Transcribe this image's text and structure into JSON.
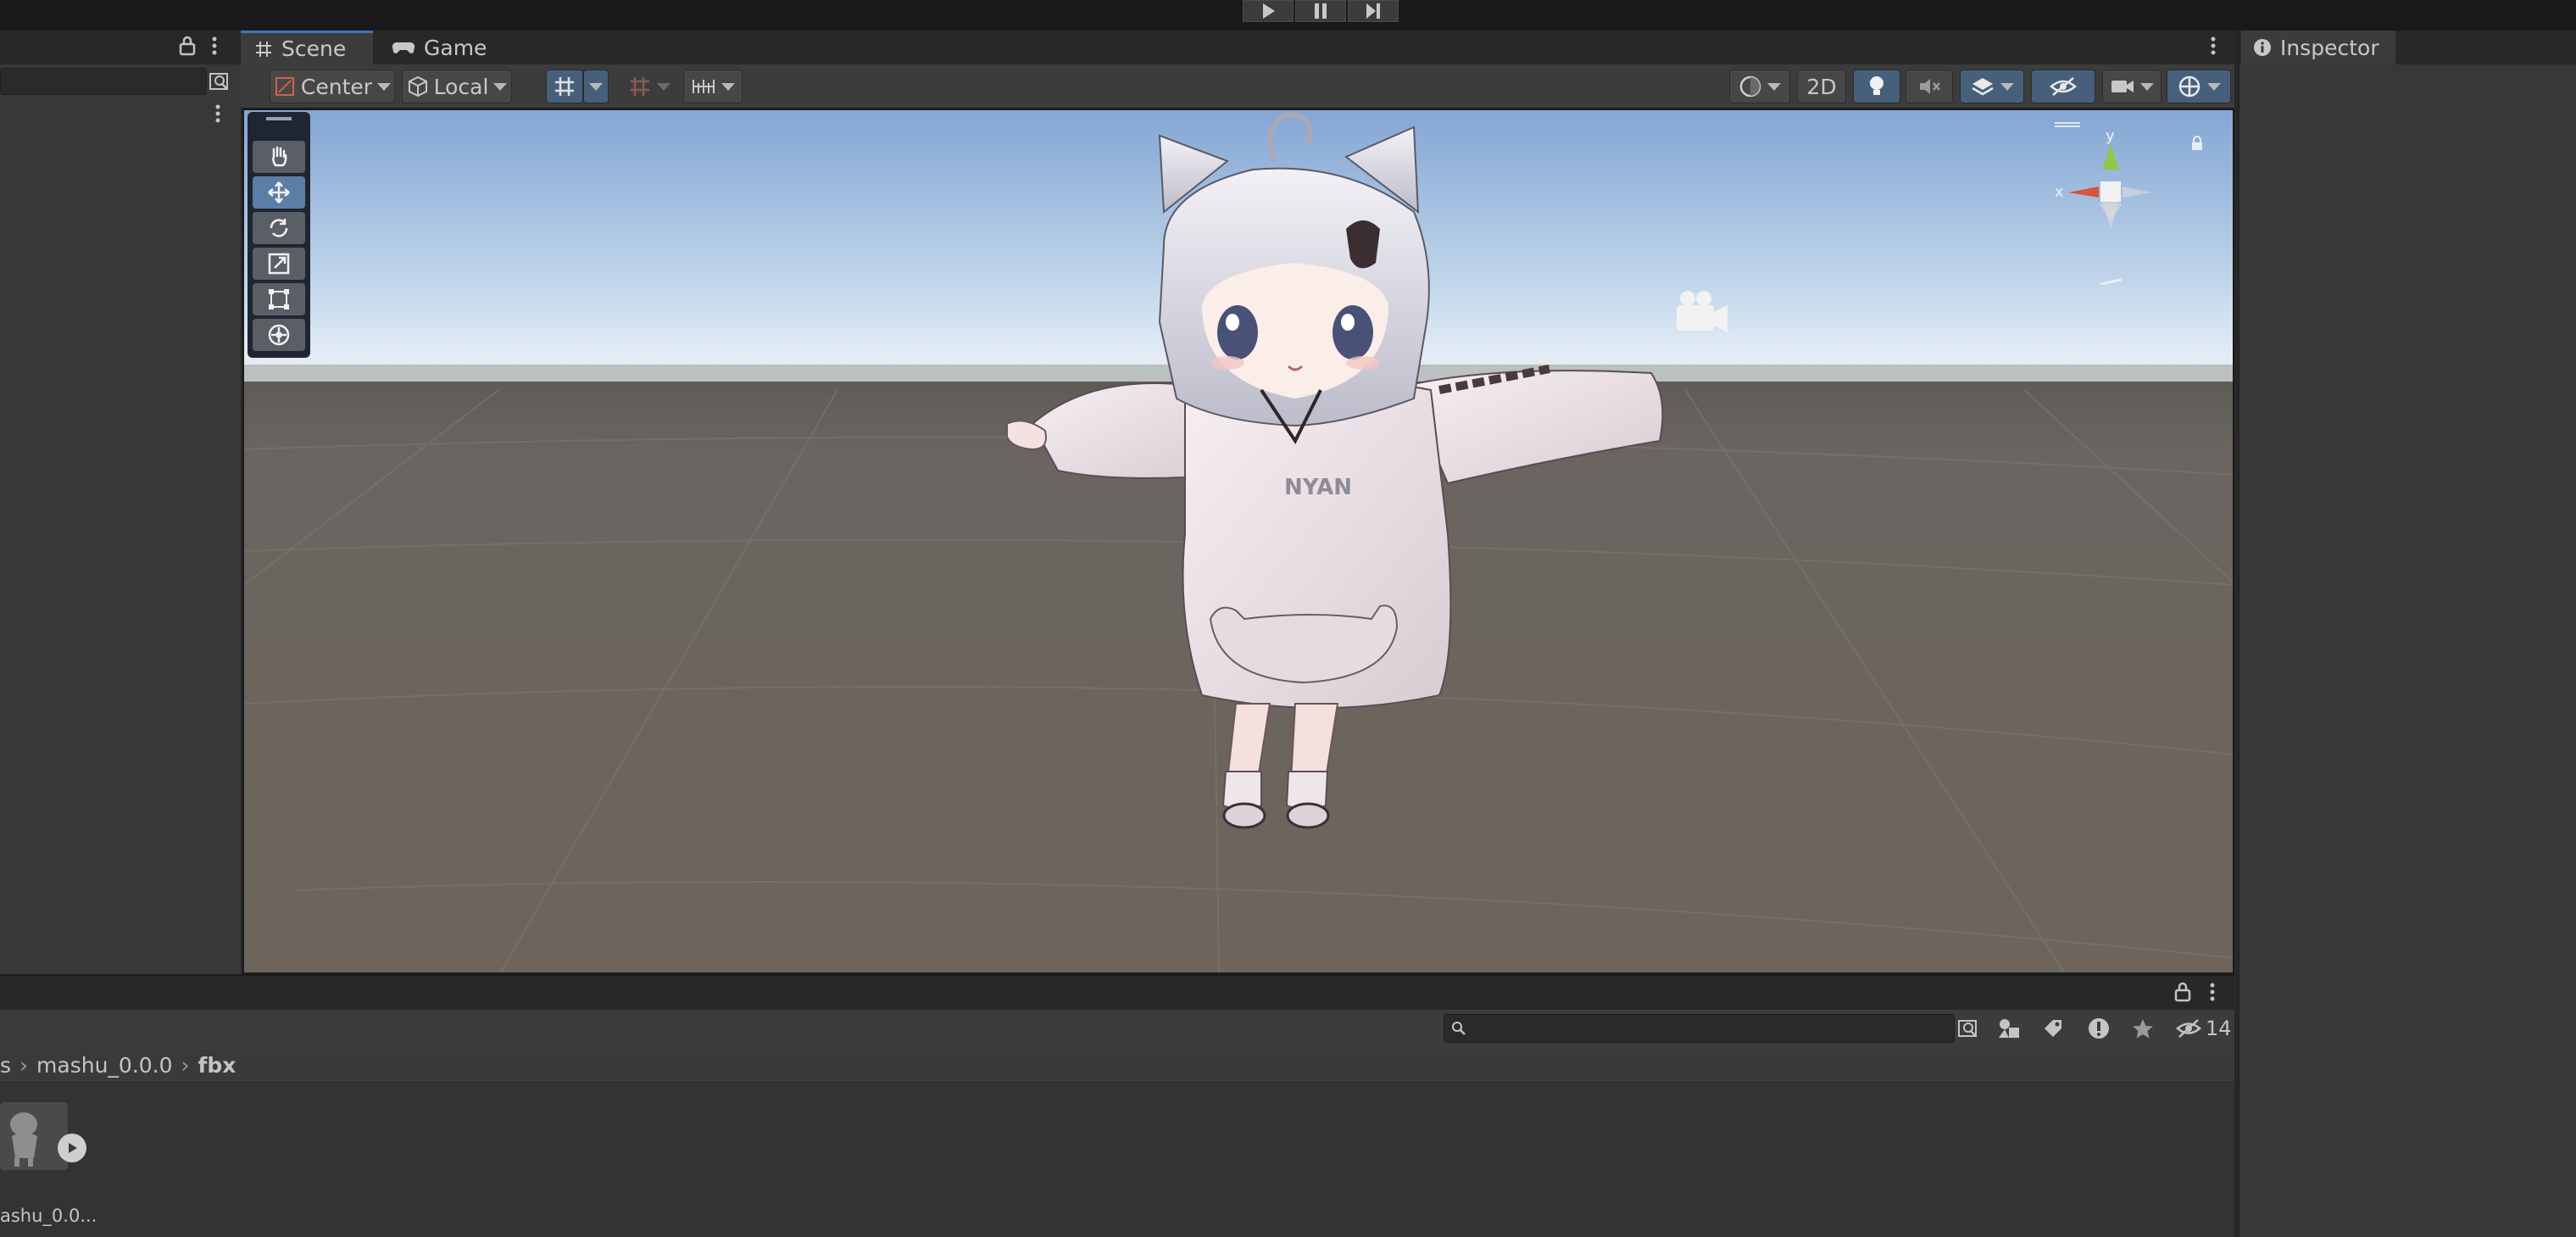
{
  "toolbar_play": {
    "play": "play",
    "pause": "pause",
    "step": "step"
  },
  "scene_tabs": {
    "scene": "Scene",
    "game": "Game"
  },
  "scene_toolbar": {
    "pivot": "Center",
    "space": "Local",
    "mode_2d": "2D"
  },
  "viewport": {
    "gizmo": {
      "y": "y",
      "x": "x"
    },
    "character_shirt_text": "NYAN"
  },
  "inspector": {
    "tab": "Inspector"
  },
  "project": {
    "breadcrumb": [
      "s",
      "mashu_0.0.0",
      "fbx"
    ],
    "hidden_count": "14",
    "asset": {
      "label": "ashu_0.0..."
    }
  },
  "colors": {
    "accent": "#3a79bb",
    "active_button": "#46607c",
    "panel": "#383838",
    "header": "#282828"
  }
}
